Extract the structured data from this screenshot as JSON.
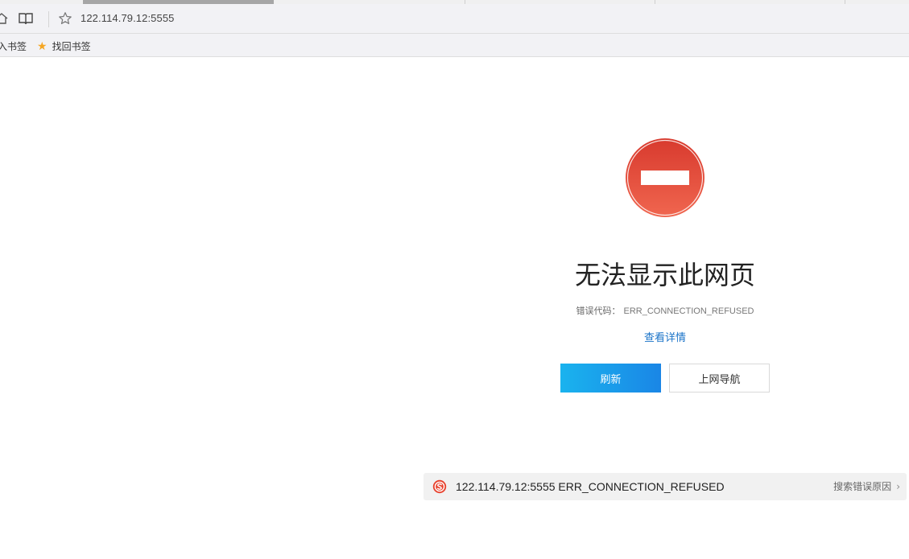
{
  "browser": {
    "address": {
      "url": "122.114.79.12:5555"
    },
    "bookmarks": {
      "items": [
        {
          "label": "入书签"
        },
        {
          "label": "找回书签"
        }
      ]
    }
  },
  "error_page": {
    "title": "无法显示此网页",
    "code_label": "错误代码：",
    "code_value": "ERR_CONNECTION_REFUSED",
    "details_link": "查看详情",
    "refresh_label": "刷新",
    "nav_label": "上网导航"
  },
  "search_suggestion": {
    "text": "122.114.79.12:5555 ERR_CONNECTION_REFUSED",
    "action_label": "搜索错误原因",
    "chevron": "›"
  },
  "colors": {
    "error_red": "#e2483a",
    "primary_blue": "#1a86e6",
    "link_blue": "#1a73c8",
    "bookmark_star": "#f5a623"
  },
  "icons": {
    "home": "home-icon",
    "reader": "reader-mode-icon",
    "favorite": "star-outline-icon",
    "bookmark_star": "star-filled-icon",
    "error": "no-entry-icon",
    "search_engine": "sogou-icon"
  }
}
